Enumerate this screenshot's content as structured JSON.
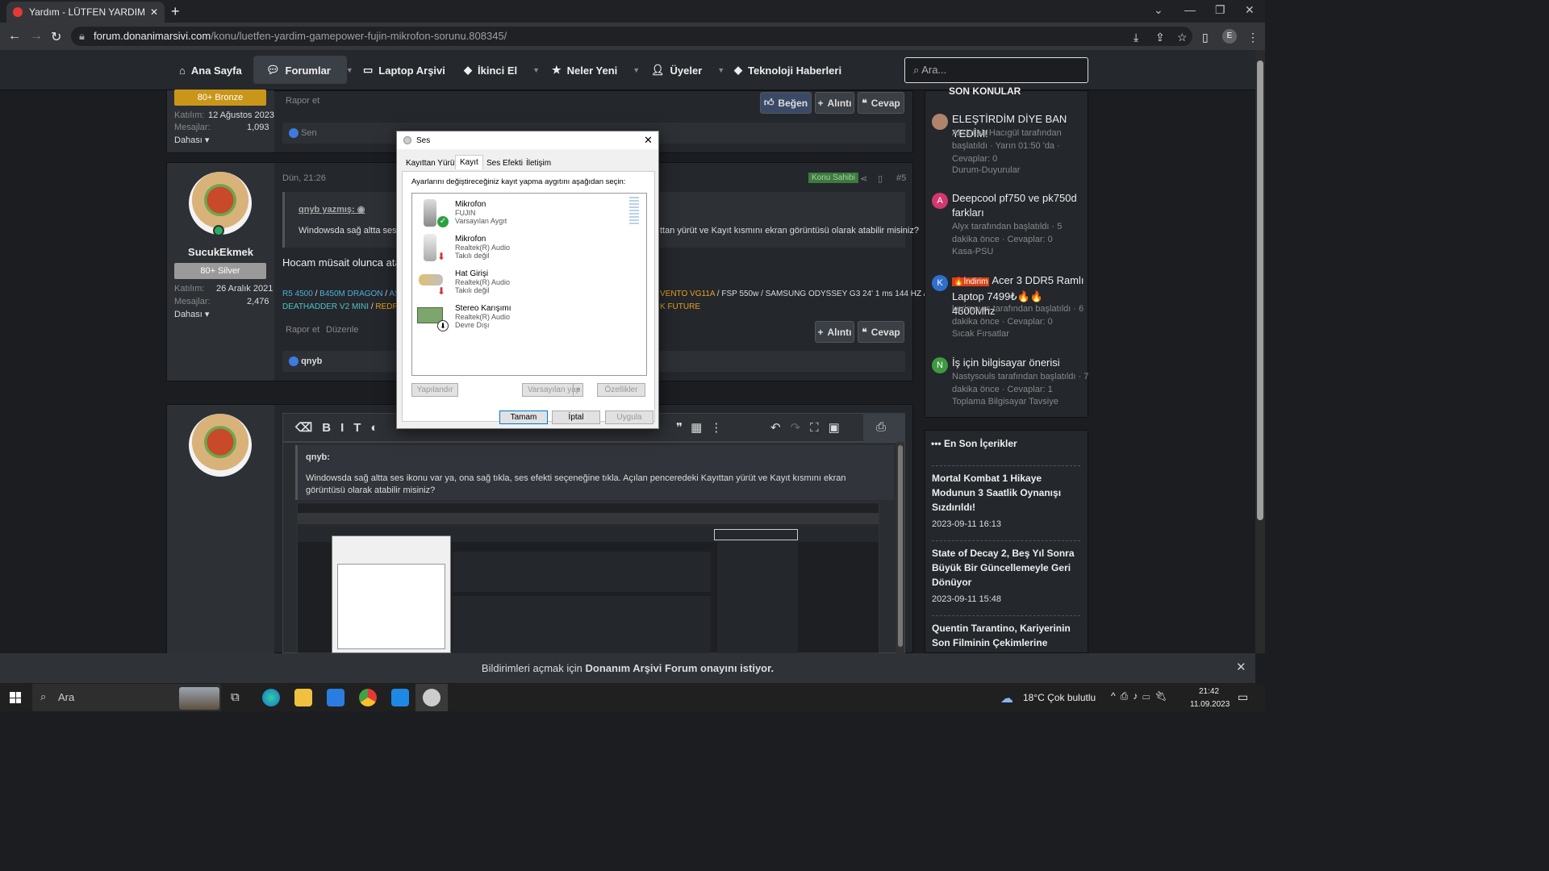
{
  "browser": {
    "tab_title": "Yardım - LÜTFEN YARDIM! GAME",
    "tab_close": "✕",
    "new_tab": "+",
    "url_host": "forum.donanimarsivi.com",
    "url_path": "/konu/luetfen-yardim-gamepower-fujin-mikrofon-sorunu.808345/",
    "profile_initial": "E"
  },
  "site_nav": {
    "home": "Ana Sayfa",
    "forums": "Forumlar",
    "laptop": "Laptop Arşivi",
    "secondhand": "İkinci El",
    "whats_new": "Neler Yeni",
    "members": "Üyeler",
    "tech_news": "Teknoloji Haberleri",
    "search_placeholder": "Ara..."
  },
  "post1": {
    "rank_badge": "80+ Bronze",
    "joined_label": "Katılım:",
    "joined": "12 Ağustos 2023",
    "messages_label": "Mesajlar:",
    "messages": "1,093",
    "more": "Dahası",
    "report": "Rapor et",
    "like_btn": "Beğen",
    "quote_btn": "Alıntı",
    "reply_btn": "Cevap",
    "likes_by": "Sen"
  },
  "post2": {
    "username": "SucukEkmek",
    "rank_badge": "80+ Silver",
    "joined_label": "Katılım:",
    "joined": "26 Aralık 2021",
    "messages_label": "Mesajlar:",
    "messages": "2,476",
    "more": "Dahası",
    "date": "Dün, 21:26",
    "op_badge": "Konu Sahibi",
    "post_no": "#5",
    "quote_author": "qnyb yazmış:",
    "quote_text_left": "Windowsda sağ altta ses ikonu",
    "quote_text_right": "ttan yürüt ve Kayıt kısmını ekran görüntüsü olarak atabilir misiniz?",
    "body": "Hocam müsait olunca atay",
    "sig_left_1a": "R5 4500",
    "sig_left_1b": "B450M DRAGON",
    "sig_left_1c": "AS",
    "sig_right_1a": "VENTO VG11A",
    "sig_right_1b": "FSP 550w",
    "sig_right_1c": "SAMSUNG ODYSSEY G3 24' 1 ms 144 HZ",
    "sig_left_2a": "DEATHADDER V2 MINI",
    "sig_left_2b": "REDRAG",
    "sig_right_2": "K FUTURE",
    "report": "Rapor et",
    "edit": "Düzenle",
    "quote_btn": "Alıntı",
    "reply_btn": "Cevap",
    "likes_by": "qnyb"
  },
  "editor": {
    "quote_author": "qnyb:",
    "quote_text": "Windowsda sağ altta ses ikonu var ya, ona sağ tıkla, ses efekti seçeneğine tıkla. Açılan penceredeki Kayıttan yürüt ve Kayıt kısmını ekran görüntüsü olarak atabilir misiniz?"
  },
  "sidebar": {
    "section_title": "SON KONULAR",
    "threads": [
      {
        "title": "ELEŞTİRDİM DİYE BAN YEDİM!",
        "meta": "Abdullah Hacıgül tarafından başlatıldı · Yarın 01:50 'da · Cevaplar: 0",
        "forum": "Durum-Duyurular",
        "initial": "",
        "color": "#b0846a"
      },
      {
        "title": "Deepcool pf750 ve pk750d farkları",
        "meta": "Alyx tarafından başlatıldı · 5 dakika önce · Cevaplar: 0",
        "forum": "Kasa-PSU",
        "initial": "A",
        "color": "#d2386f"
      },
      {
        "prefix": "🔥İndirim",
        "title": "Acer 3 DDR5 Ramlı Laptop 7499₺🔥🔥4800Mhz",
        "meta": "kerimavrs tarafından başlatıldı · 6 dakika önce · Cevaplar: 0",
        "forum": "Sıcak Fırsatlar",
        "initial": "K",
        "color": "#2f6fce"
      },
      {
        "title": "İş için bilgisayar önerisi",
        "meta": "Nastysouls tarafından başlatıldı · 7 dakika önce · Cevaplar: 1",
        "forum": "Toplama Bilgisayar Tavsiye",
        "initial": "N",
        "color": "#3f9a3f"
      }
    ],
    "latest_title": "En Son İçerikler",
    "latest": [
      {
        "title": "Mortal Kombat 1 Hikaye Modunun 3 Saatlik Oynanışı Sızdırıldı!",
        "date": "2023-09-11 16:13"
      },
      {
        "title": "State of Decay 2, Beş Yıl Sonra Büyük Bir Güncellemeyle Geri Dönüyor",
        "date": "2023-09-11 15:48"
      },
      {
        "title": "Quentin Tarantino, Kariyerinin Son Filminin Çekimlerine Başlıyor",
        "date": ""
      }
    ]
  },
  "dialog": {
    "title": "Ses",
    "tabs": [
      "Kayıttan Yürüt",
      "Kayıt",
      "Ses Efekti",
      "İletişim"
    ],
    "instruction": "Ayarlarını değiştireceğiniz kayıt yapma aygıtını aşağıdan seçin:",
    "devices": [
      {
        "name": "Mikrofon",
        "driver": "FUJIN",
        "status": "Varsayılan Aygıt"
      },
      {
        "name": "Mikrofon",
        "driver": "Realtek(R) Audio",
        "status": "Takılı değil"
      },
      {
        "name": "Hat Girişi",
        "driver": "Realtek(R) Audio",
        "status": "Takılı değil"
      },
      {
        "name": "Stereo Karışımı",
        "driver": "Realtek(R) Audio",
        "status": "Devre Dışı"
      }
    ],
    "configure": "Yapılandır",
    "set_default": "Varsayılan yap",
    "properties": "Özellikler",
    "ok": "Tamam",
    "cancel": "İptal",
    "apply": "Uygula"
  },
  "notification": {
    "prefix": "Bildirimleri açmak için",
    "bold": "Donanım Arşivi Forum onayını istiyor."
  },
  "taskbar": {
    "search": "Ara",
    "weather": "18°C  Çok bulutlu",
    "time": "21:42",
    "date": "11.09.2023"
  },
  "colors": {
    "bronze": "#c9961a",
    "silver": "#9a9a9a",
    "accent": "#3d7be0",
    "op_badge": "#3e7a3e"
  }
}
